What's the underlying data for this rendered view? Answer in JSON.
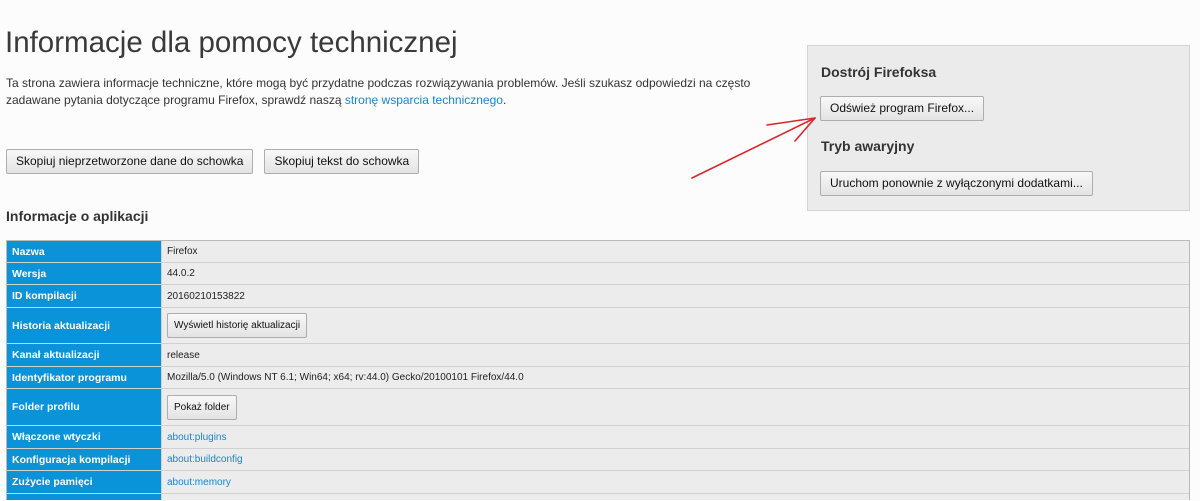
{
  "page": {
    "title": "Informacje dla pomocy technicznej"
  },
  "intro": {
    "line1": "Ta strona zawiera informacje techniczne, które mogą być przydatne podczas rozwiązywania problemów. Jeśli szukasz odpowiedzi na często",
    "line2_before_link": "zadawane pytania dotyczące programu Firefox, sprawdź naszą ",
    "link_text": "stronę wsparcia technicznego",
    "after_link": "."
  },
  "copy_buttons": {
    "raw": "Skopiuj nieprzetworzone dane do schowka",
    "text": "Skopiuj tekst do schowka"
  },
  "side_box": {
    "refresh_heading": "Dostrój Firefoksa",
    "refresh_button": "Odśwież program Firefox...",
    "safe_mode_heading": "Tryb awaryjny",
    "safe_mode_button": "Uruchom ponownie z wyłączonymi dodatkami..."
  },
  "app_info": {
    "heading": "Informacje o aplikacji",
    "rows": [
      {
        "label": "Nazwa",
        "value": "Firefox"
      },
      {
        "label": "Wersja",
        "value": "44.0.2"
      },
      {
        "label": "ID kompilacji",
        "value": "20160210153822"
      },
      {
        "label": "Historia aktualizacji",
        "button": "Wyświetl historię aktualizacji"
      },
      {
        "label": "Kanał aktualizacji",
        "value": "release"
      },
      {
        "label": "Identyfikator programu",
        "value": "Mozilla/5.0 (Windows NT 6.1; Win64; x64; rv:44.0) Gecko/20100101 Firefox/44.0"
      },
      {
        "label": "Folder profilu",
        "button": "Pokaż folder"
      },
      {
        "label": "Włączone wtyczki",
        "link": "about:plugins"
      },
      {
        "label": "Konfiguracja kompilacji",
        "link": "about:buildconfig"
      },
      {
        "label": "Zużycie pamięci",
        "link": "about:memory"
      }
    ]
  },
  "colors": {
    "page_bg": "#fcfcfc",
    "text": "#333333",
    "label_bg": "#0a93d9",
    "label_text": "#ffffff",
    "value_bg": "#ececec",
    "link": "#1a84c9",
    "side_box_bg": "#ebebeb",
    "annotation_arrow": "#d8262b"
  }
}
